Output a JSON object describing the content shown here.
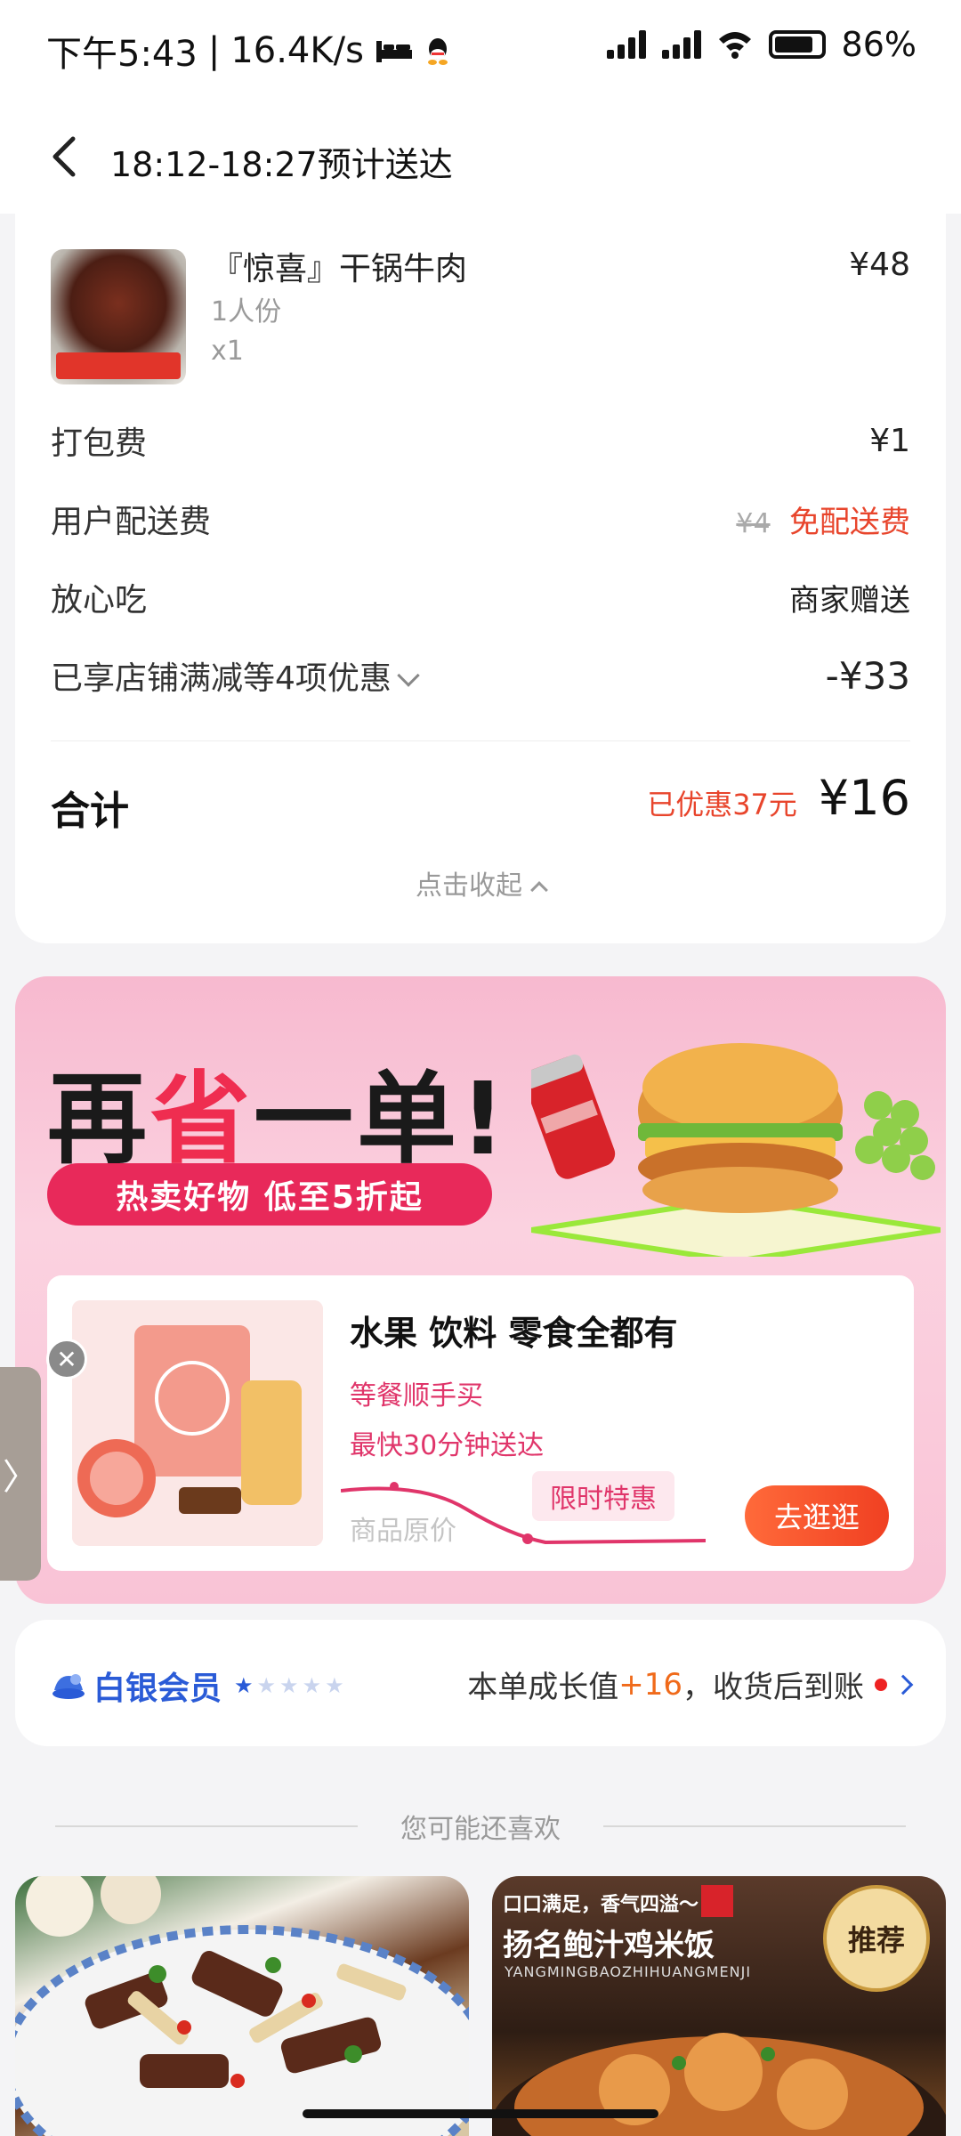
{
  "status_bar": {
    "time": "下午5:43",
    "network_speed": "16.4K/s",
    "battery": "86%"
  },
  "header": {
    "title": "18:12-18:27预计送达"
  },
  "order": {
    "item": {
      "name": "『惊喜』干锅牛肉",
      "portion": "1人份",
      "quantity": "x1",
      "price": "¥48"
    },
    "packing_fee": {
      "label": "打包费",
      "value": "¥1"
    },
    "delivery_fee": {
      "label": "用户配送费",
      "original": "¥4",
      "value": "免配送费"
    },
    "assurance": {
      "label": "放心吃",
      "value": "商家赠送"
    },
    "discounts": {
      "label": "已享店铺满减等4项优惠",
      "value": "-¥33"
    },
    "total": {
      "label": "合计",
      "saved": "已优惠37元",
      "value": "¥16"
    },
    "collapse_label": "点击收起"
  },
  "promo": {
    "title_part1": "再",
    "title_accent": "省",
    "title_part2": "一单!",
    "pill": "热卖好物 低至5折起",
    "card_title": "水果 饮料 零食全都有",
    "line1": "等餐顺手买",
    "line2": "最快30分钟送达",
    "original_price_label": "商品原价",
    "limited_label": "限时特惠",
    "button": "去逛逛"
  },
  "member": {
    "level": "白银会员",
    "stars_filled": 1,
    "stars_total": 5,
    "text_before": "本单成长值",
    "growth": "+16",
    "text_after": "，收货后到账"
  },
  "recommend": {
    "header": "您可能还喜欢",
    "card2_tag": "口口满足，香气四溢～",
    "card2_name": "扬名鲍汁鸡米饭",
    "card2_pinyin": "YANGMINGBAOZHIHUANGMENJI",
    "card2_badge": "推荐"
  },
  "colors": {
    "accent_red": "#e8452c",
    "member_blue": "#2a5bd7",
    "promo_pink": "#e8295a"
  }
}
